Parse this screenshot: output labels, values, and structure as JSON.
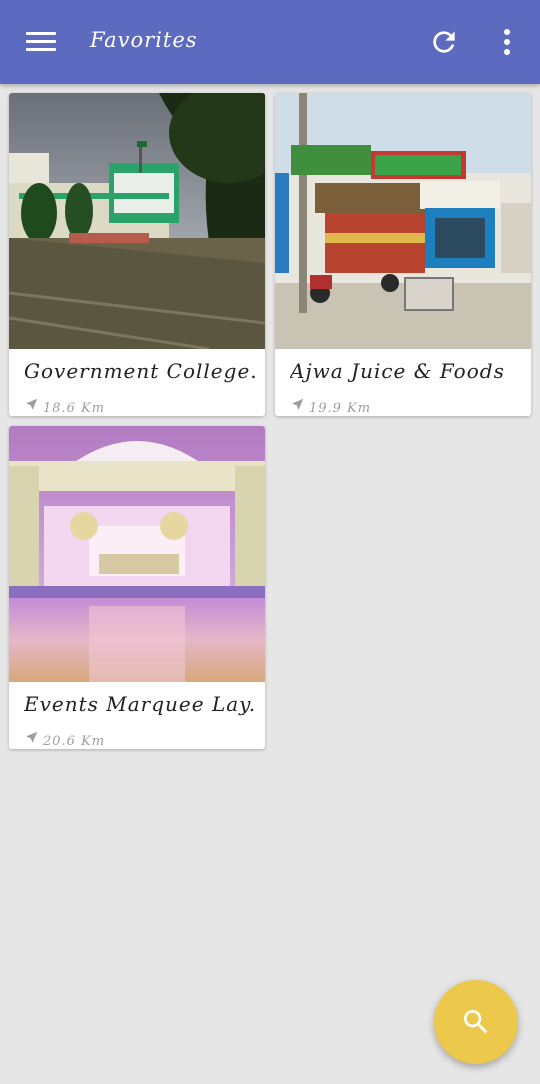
{
  "app_bar": {
    "title": "Favorites",
    "background": "#5c6bc0",
    "icons": [
      "menu-icon",
      "refresh-icon",
      "more-vert-icon"
    ]
  },
  "favorites": [
    {
      "title": "Government College...",
      "distance": "18.6 Km"
    },
    {
      "title": "Ajwa Juice & Foods",
      "distance": "19.9 Km"
    },
    {
      "title": "Events Marquee Lay...",
      "distance": "20.6 Km"
    }
  ],
  "fab": {
    "icon": "search-icon",
    "color": "#ecc94b"
  }
}
